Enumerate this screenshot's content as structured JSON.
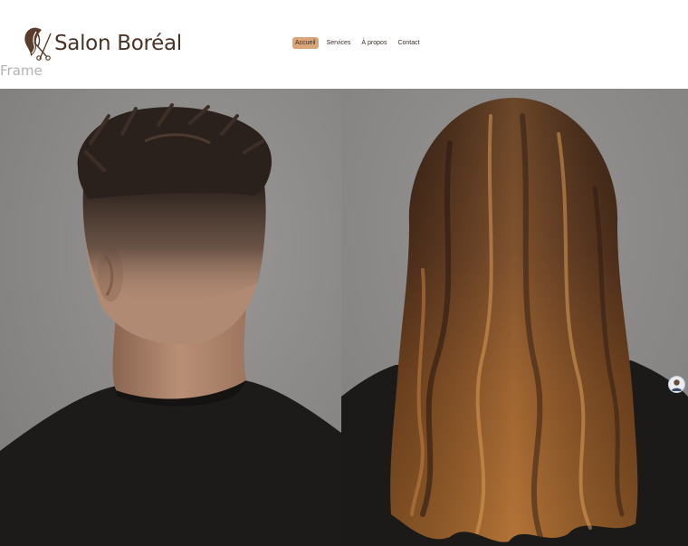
{
  "brand": {
    "name": "Salon Boréal",
    "logo_icon": "woman-profile-scissors-icon"
  },
  "frame_label": "Frame",
  "nav": {
    "items": [
      {
        "label": "Accueil",
        "active": true
      },
      {
        "label": "Services",
        "active": false
      },
      {
        "label": "À propos",
        "active": false
      },
      {
        "label": "Contact",
        "active": false
      }
    ]
  },
  "hero": {
    "left_image": "man-fade-haircut-back-view",
    "right_image": "woman-long-wavy-balayage-hair-back-view"
  },
  "chat": {
    "icon": "chat-avatar-icon"
  },
  "colors": {
    "brand_text": "#4a3226",
    "nav_active_bg": "#d9a679",
    "backdrop_gray": "#8e8c8a"
  }
}
